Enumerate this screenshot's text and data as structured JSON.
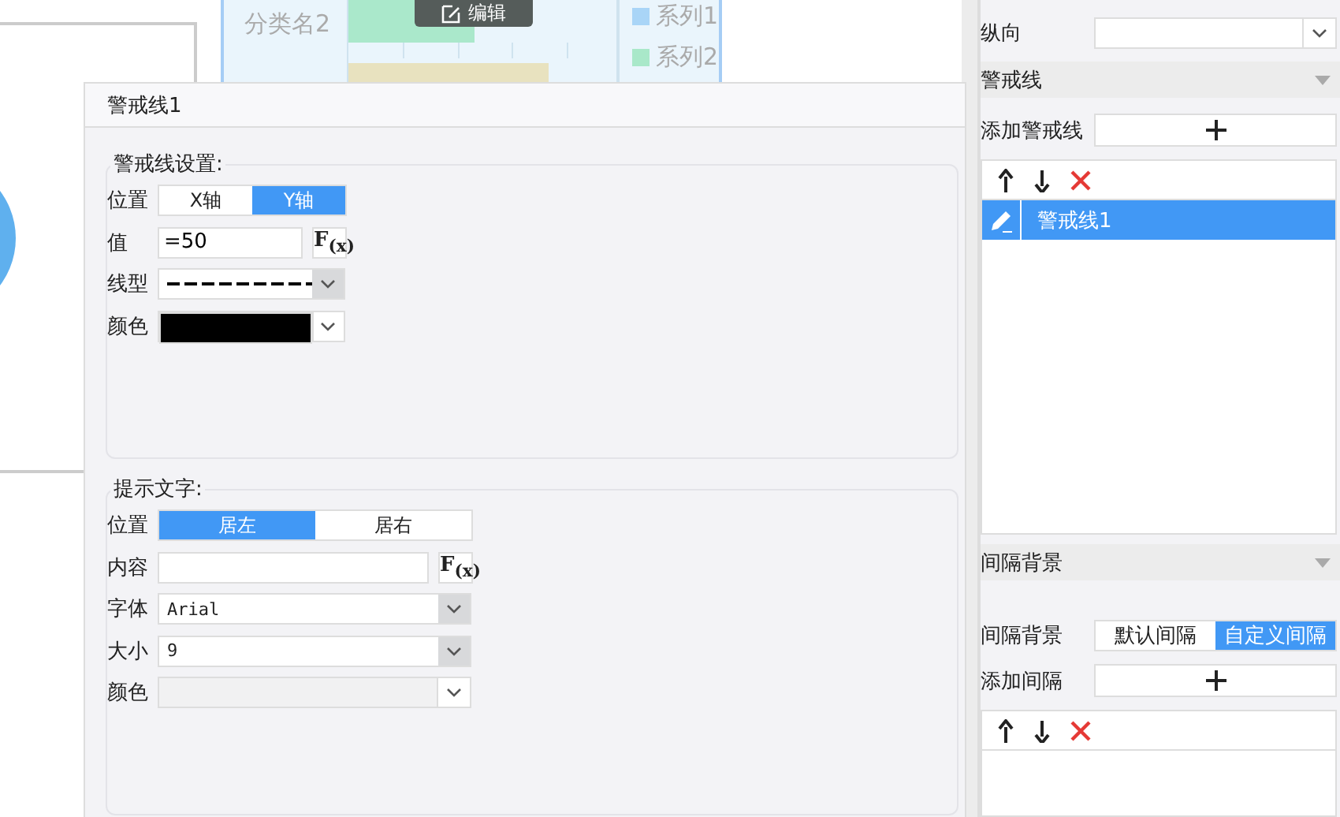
{
  "canvas": {
    "chart_card": {
      "category_label": "分类名2",
      "edit_button": "编辑",
      "legend": [
        {
          "label": "系列1",
          "color": "#a9d5f7"
        },
        {
          "label": "系列2",
          "color": "#a9e8c9"
        }
      ]
    }
  },
  "dialog": {
    "title": "警戒线1",
    "line_settings": {
      "legend": "警戒线设置:",
      "position": {
        "label": "位置",
        "options": [
          {
            "label": "X轴",
            "selected": false
          },
          {
            "label": "Y轴",
            "selected": true
          }
        ]
      },
      "value": {
        "label": "值",
        "value": "=50",
        "formula_button": "F$_{(x)}$"
      },
      "line_type": {
        "label": "线型",
        "kind": "dashed"
      },
      "color": {
        "label": "颜色",
        "color": "#000000"
      }
    },
    "hint_text": {
      "legend": "提示文字:",
      "position": {
        "label": "位置",
        "options": [
          {
            "label": "居左",
            "selected": true
          },
          {
            "label": "居右",
            "selected": false
          }
        ]
      },
      "content": {
        "label": "内容",
        "formula_button": "F$_{(x)}$"
      },
      "font": {
        "label": "字体",
        "value": "Arial"
      },
      "size": {
        "label": "大小",
        "value": "9"
      },
      "color": {
        "label": "颜色",
        "disabled": true
      }
    }
  },
  "side_panel": {
    "orientation": {
      "label": "纵向"
    },
    "sections": [
      {
        "title": "警戒线",
        "add_label": "添加警戒线",
        "items": [
          {
            "label": "警戒线1",
            "selected": true
          }
        ]
      },
      {
        "title": "间隔背景",
        "mode": {
          "label": "间隔背景",
          "options": [
            {
              "label": "默认间隔",
              "selected": false
            },
            {
              "label": "自定义间隔",
              "selected": true
            }
          ]
        },
        "add_label": "添加间隔"
      }
    ]
  }
}
